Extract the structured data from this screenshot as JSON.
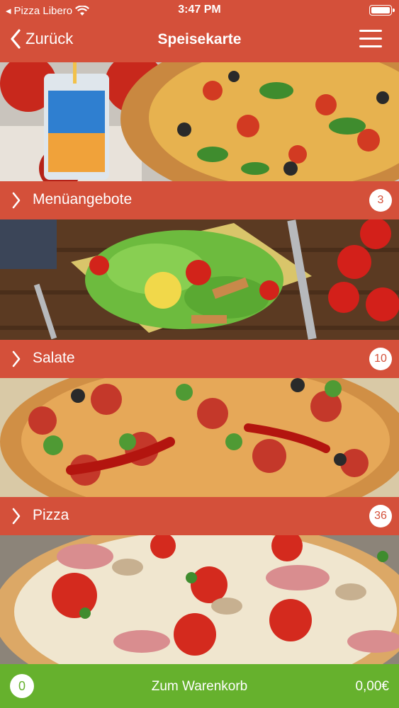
{
  "status_bar": {
    "carrier": "Pizza Libero",
    "time": "3:47 PM"
  },
  "nav": {
    "back_label": "Zurück",
    "title": "Speisekarte"
  },
  "categories": [
    {
      "label": "Menüangebote",
      "count": "3"
    },
    {
      "label": "Salate",
      "count": "10"
    },
    {
      "label": "Pizza",
      "count": "36"
    }
  ],
  "cart": {
    "count": "0",
    "label": "Zum Warenkorb",
    "total": "0,00€"
  },
  "colors": {
    "primary": "#d4503a",
    "cart_green": "#66b12d"
  }
}
